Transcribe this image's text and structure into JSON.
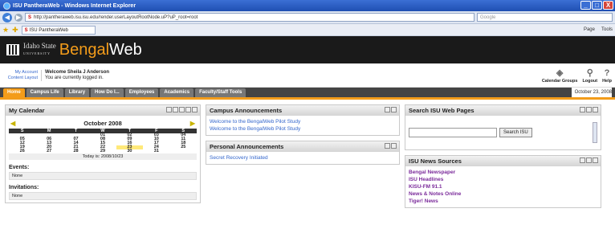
{
  "window": {
    "title": "ISU PantheraWeb - Windows Internet Explorer",
    "minimize": "_",
    "maximize": "□",
    "close": "X"
  },
  "browser": {
    "back": "◀",
    "forward": "▶",
    "url": "http://pantheraweb.isu.isu.edu/render.userLayoutRootNode.uP?uP_root=root",
    "search_placeholder": "Google",
    "tab_title": "ISU PantheraWeb",
    "tools": [
      "Page",
      "Tools"
    ]
  },
  "brand": {
    "isu_line1": "Idaho State",
    "isu_line2": "UNIVERSITY",
    "bengal": "Bengal",
    "web": "Web"
  },
  "user": {
    "links": [
      "My Account",
      "Content Layout"
    ],
    "welcome": "Welcome Sheila J Anderson",
    "status": "You are currently logged in.",
    "icons": [
      {
        "name": "calendar-groups",
        "label": "Calendar Groups",
        "glyph": "◈"
      },
      {
        "name": "logout",
        "label": "Logout",
        "glyph": "⚲"
      },
      {
        "name": "help",
        "label": "Help",
        "glyph": "?"
      }
    ]
  },
  "nav": {
    "tabs": [
      "Home",
      "Campus Life",
      "Library",
      "How Do I...",
      "Employees",
      "Academics",
      "Faculty/Staff Tools"
    ],
    "date": "October 23, 2008"
  },
  "calendar": {
    "title": "My Calendar",
    "month": "October 2008",
    "days": [
      "S",
      "M",
      "T",
      "W",
      "T",
      "F",
      "S"
    ],
    "weeks": [
      [
        "",
        "",
        "",
        "01",
        "02",
        "03",
        "04"
      ],
      [
        "05",
        "06",
        "07",
        "08",
        "09",
        "10",
        "11"
      ],
      [
        "12",
        "13",
        "14",
        "15",
        "16",
        "17",
        "18"
      ],
      [
        "19",
        "20",
        "21",
        "22",
        "23",
        "24",
        "25"
      ],
      [
        "26",
        "27",
        "28",
        "29",
        "30",
        "31",
        ""
      ]
    ],
    "today": "Today is: 2008/10/23",
    "events_label": "Events:",
    "events_value": "None",
    "invitations_label": "Invitations:",
    "invitations_value": "None"
  },
  "campus": {
    "title": "Campus Announcements",
    "items": [
      "Welcome to the BengalWeb Pilot Study",
      "Welcome to the BengalWeb Pilot Study"
    ]
  },
  "personal": {
    "title": "Personal Announcements",
    "items": [
      "Secret Recovery Initiated"
    ]
  },
  "search": {
    "title": "Search ISU Web Pages",
    "button": "Search ISU"
  },
  "news": {
    "title": "ISU News Sources",
    "items": [
      "Bengal Newspaper",
      "ISU Headlines",
      "KISU-FM 91.1",
      "News & Notes Online",
      "Tiger! News"
    ]
  }
}
